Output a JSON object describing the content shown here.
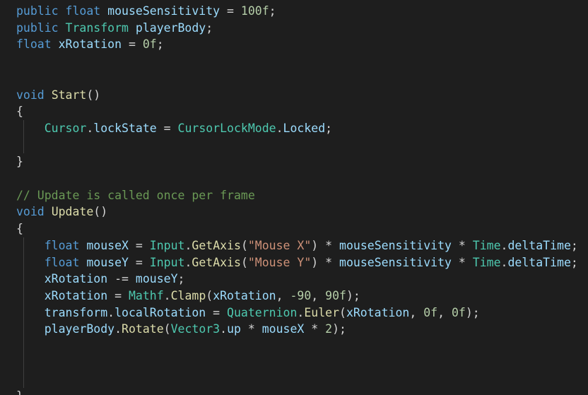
{
  "editor": {
    "lines": [
      {
        "tokens": [
          [
            "kw",
            "public"
          ],
          [
            "pl",
            " "
          ],
          [
            "kw",
            "float"
          ],
          [
            "pl",
            " "
          ],
          [
            "var",
            "mouseSensitivity"
          ],
          [
            "pl",
            " = "
          ],
          [
            "num",
            "100f"
          ],
          [
            "pl",
            ";"
          ]
        ]
      },
      {
        "tokens": [
          [
            "kw",
            "public"
          ],
          [
            "pl",
            " "
          ],
          [
            "type",
            "Transform"
          ],
          [
            "pl",
            " "
          ],
          [
            "var",
            "playerBody"
          ],
          [
            "pl",
            ";"
          ]
        ]
      },
      {
        "tokens": [
          [
            "kw",
            "float"
          ],
          [
            "pl",
            " "
          ],
          [
            "var",
            "xRotation"
          ],
          [
            "pl",
            " = "
          ],
          [
            "num",
            "0f"
          ],
          [
            "pl",
            ";"
          ]
        ]
      },
      {
        "tokens": []
      },
      {
        "tokens": []
      },
      {
        "tokens": [
          [
            "kw",
            "void"
          ],
          [
            "pl",
            " "
          ],
          [
            "fn",
            "Start"
          ],
          [
            "pl",
            "()"
          ]
        ]
      },
      {
        "tokens": [
          [
            "pl",
            "{"
          ]
        ]
      },
      {
        "tokens": [
          [
            "pl",
            "    "
          ],
          [
            "type",
            "Cursor"
          ],
          [
            "pl",
            "."
          ],
          [
            "var",
            "lockState"
          ],
          [
            "pl",
            " = "
          ],
          [
            "type",
            "CursorLockMode"
          ],
          [
            "pl",
            "."
          ],
          [
            "var",
            "Locked"
          ],
          [
            "pl",
            ";"
          ]
        ]
      },
      {
        "tokens": []
      },
      {
        "tokens": [
          [
            "pl",
            "}"
          ]
        ]
      },
      {
        "tokens": []
      },
      {
        "tokens": [
          [
            "cmt",
            "// Update is called once per frame"
          ]
        ]
      },
      {
        "tokens": [
          [
            "kw",
            "void"
          ],
          [
            "pl",
            " "
          ],
          [
            "fn",
            "Update"
          ],
          [
            "pl",
            "()"
          ]
        ]
      },
      {
        "tokens": [
          [
            "pl",
            "{"
          ]
        ]
      },
      {
        "tokens": [
          [
            "pl",
            "    "
          ],
          [
            "kw",
            "float"
          ],
          [
            "pl",
            " "
          ],
          [
            "var",
            "mouseX"
          ],
          [
            "pl",
            " = "
          ],
          [
            "type",
            "Input"
          ],
          [
            "pl",
            "."
          ],
          [
            "fn",
            "GetAxis"
          ],
          [
            "pl",
            "("
          ],
          [
            "str",
            "\"Mouse X\""
          ],
          [
            "pl",
            ") * "
          ],
          [
            "var",
            "mouseSensitivity"
          ],
          [
            "pl",
            " * "
          ],
          [
            "type",
            "Time"
          ],
          [
            "pl",
            "."
          ],
          [
            "var",
            "deltaTime"
          ],
          [
            "pl",
            ";"
          ]
        ]
      },
      {
        "tokens": [
          [
            "pl",
            "    "
          ],
          [
            "kw",
            "float"
          ],
          [
            "pl",
            " "
          ],
          [
            "var",
            "mouseY"
          ],
          [
            "pl",
            " = "
          ],
          [
            "type",
            "Input"
          ],
          [
            "pl",
            "."
          ],
          [
            "fn",
            "GetAxis"
          ],
          [
            "pl",
            "("
          ],
          [
            "str",
            "\"Mouse Y\""
          ],
          [
            "pl",
            ") * "
          ],
          [
            "var",
            "mouseSensitivity"
          ],
          [
            "pl",
            " * "
          ],
          [
            "type",
            "Time"
          ],
          [
            "pl",
            "."
          ],
          [
            "var",
            "deltaTime"
          ],
          [
            "pl",
            ";"
          ]
        ]
      },
      {
        "tokens": [
          [
            "pl",
            "    "
          ],
          [
            "var",
            "xRotation"
          ],
          [
            "pl",
            " -= "
          ],
          [
            "var",
            "mouseY"
          ],
          [
            "pl",
            ";"
          ]
        ]
      },
      {
        "tokens": [
          [
            "pl",
            "    "
          ],
          [
            "var",
            "xRotation"
          ],
          [
            "pl",
            " = "
          ],
          [
            "type",
            "Mathf"
          ],
          [
            "pl",
            "."
          ],
          [
            "fn",
            "Clamp"
          ],
          [
            "pl",
            "("
          ],
          [
            "var",
            "xRotation"
          ],
          [
            "pl",
            ", "
          ],
          [
            "num",
            "-90"
          ],
          [
            "pl",
            ", "
          ],
          [
            "num",
            "90f"
          ],
          [
            "pl",
            ");"
          ]
        ]
      },
      {
        "tokens": [
          [
            "pl",
            "    "
          ],
          [
            "var",
            "transform"
          ],
          [
            "pl",
            "."
          ],
          [
            "var",
            "localRotation"
          ],
          [
            "pl",
            " = "
          ],
          [
            "type",
            "Quaternion"
          ],
          [
            "pl",
            "."
          ],
          [
            "fn",
            "Euler"
          ],
          [
            "pl",
            "("
          ],
          [
            "var",
            "xRotation"
          ],
          [
            "pl",
            ", "
          ],
          [
            "num",
            "0f"
          ],
          [
            "pl",
            ", "
          ],
          [
            "num",
            "0f"
          ],
          [
            "pl",
            ");"
          ]
        ]
      },
      {
        "tokens": [
          [
            "pl",
            "    "
          ],
          [
            "var",
            "playerBody"
          ],
          [
            "pl",
            "."
          ],
          [
            "fn",
            "Rotate"
          ],
          [
            "pl",
            "("
          ],
          [
            "type",
            "Vector3"
          ],
          [
            "pl",
            "."
          ],
          [
            "var",
            "up"
          ],
          [
            "pl",
            " * "
          ],
          [
            "var",
            "mouseX"
          ],
          [
            "pl",
            " * "
          ],
          [
            "num",
            "2"
          ],
          [
            "pl",
            ");"
          ]
        ]
      },
      {
        "tokens": []
      },
      {
        "tokens": []
      },
      {
        "tokens": []
      },
      {
        "tokens": [
          [
            "pl",
            "}"
          ]
        ]
      }
    ]
  },
  "colors": {
    "background": "#1e1e1e",
    "keyword": "#569cd6",
    "type": "#4ec9b0",
    "method": "#dcdcaa",
    "variable": "#9cdcfe",
    "number": "#b5cea8",
    "string": "#ce9178",
    "comment": "#6a9955",
    "plain": "#d4d4d4"
  }
}
